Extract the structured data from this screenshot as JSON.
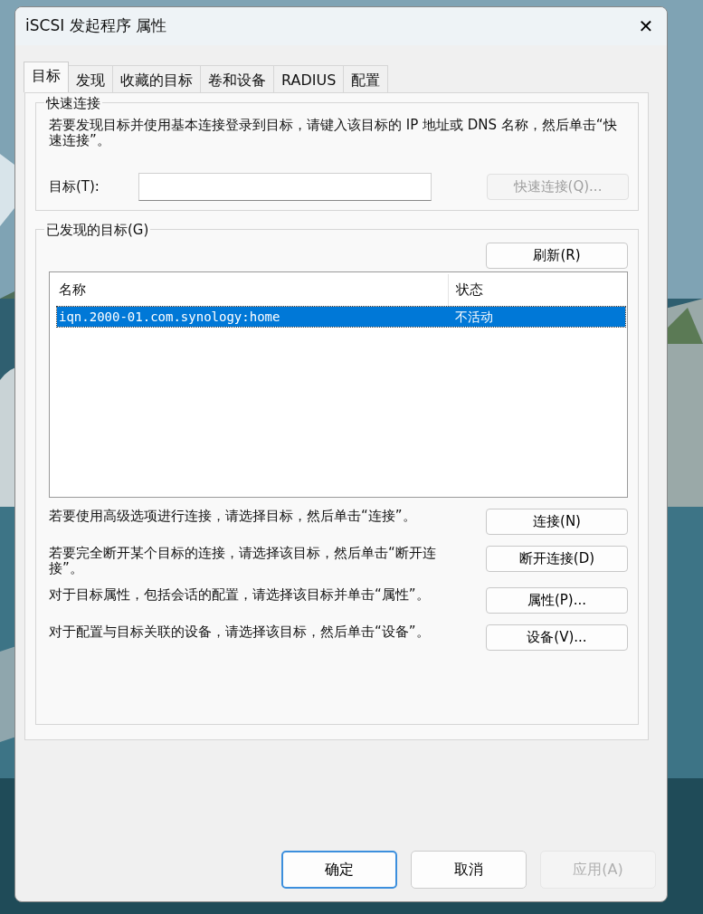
{
  "window": {
    "title": "iSCSI 发起程序 属性",
    "close": "✕"
  },
  "tabs": [
    {
      "label": "目标",
      "selected": true
    },
    {
      "label": "发现",
      "selected": false
    },
    {
      "label": "收藏的目标",
      "selected": false
    },
    {
      "label": "卷和设备",
      "selected": false
    },
    {
      "label": "RADIUS",
      "selected": false
    },
    {
      "label": "配置",
      "selected": false
    }
  ],
  "quick_connect": {
    "title": "快速连接",
    "description": "若要发现目标并使用基本连接登录到目标，请键入该目标的 IP 地址或 DNS 名称，然后单击“快速连接”。",
    "target_label": "目标(T):",
    "button": {
      "label": "快速连接(Q)...",
      "disabled": true
    }
  },
  "discovered": {
    "title": "已发现的目标(G)",
    "refresh": {
      "label": "刷新(R)",
      "disabled": false
    },
    "table": {
      "columns": [
        "名称",
        "状态"
      ],
      "rows": [
        {
          "cells": [
            "iqn.2000-01.com.synology:home",
            "不活动"
          ],
          "selected": true
        }
      ]
    },
    "actions": [
      {
        "description": "若要使用高级选项进行连接，请选择目标，然后单击“连接”。",
        "button": {
          "label": "连接(N)",
          "disabled": false
        }
      },
      {
        "description": "若要完全断开某个目标的连接，请选择该目标，然后单击“断开连接”。",
        "button": {
          "label": "断开连接(D)",
          "disabled": false
        }
      },
      {
        "description": "对于目标属性，包括会话的配置，请选择该目标并单击“属性”。",
        "button": {
          "label": "属性(P)...",
          "disabled": false
        }
      },
      {
        "description": "对于配置与目标关联的设备，请选择该目标，然后单击“设备”。",
        "button": {
          "label": "设备(V)...",
          "disabled": false
        }
      }
    ]
  },
  "buttons": [
    {
      "label": "确定",
      "default": true,
      "disabled": false
    },
    {
      "label": "取消",
      "default": false,
      "disabled": false
    },
    {
      "label": "应用(A)",
      "default": false,
      "disabled": true
    }
  ]
}
